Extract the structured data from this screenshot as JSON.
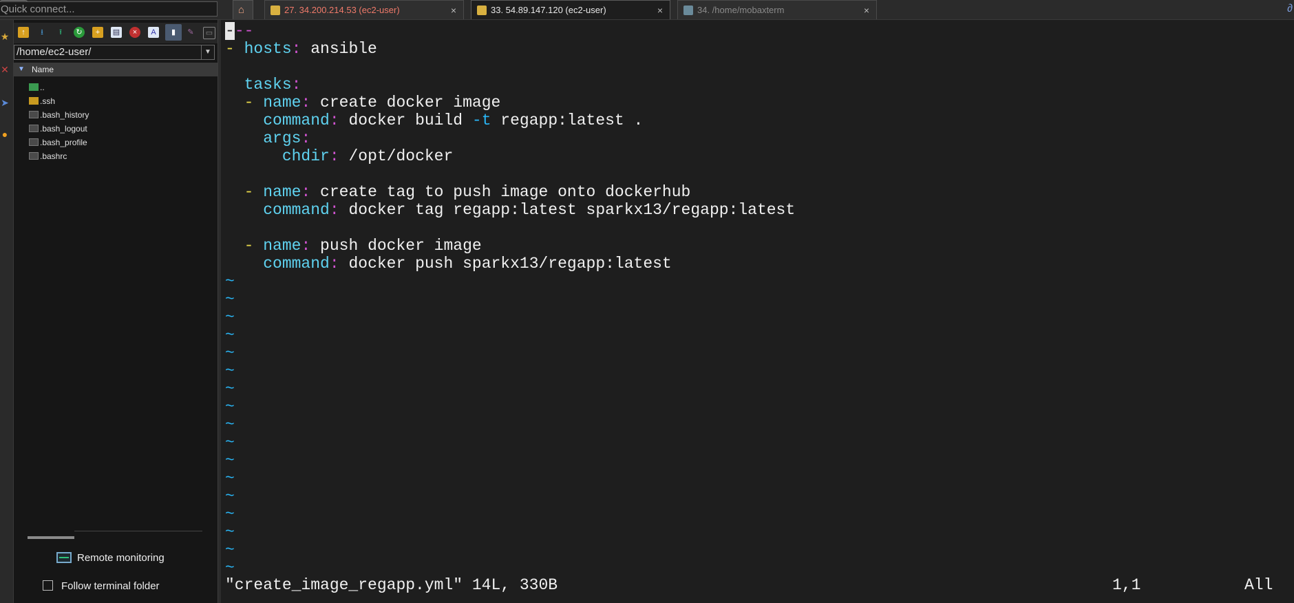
{
  "quick_connect": {
    "placeholder": "Quick connect..."
  },
  "tabs": [
    {
      "label": "27. 34.200.214.53 (ec2-user)"
    },
    {
      "label": "33. 54.89.147.120 (ec2-user)"
    },
    {
      "label": "34. /home/mobaxterm"
    }
  ],
  "close_glyph": "×",
  "add_tab_glyph": "+",
  "sidebar": {
    "path": "/home/ec2-user/",
    "column_name": "Name",
    "files": [
      {
        "name": "..",
        "icon": "parent-folder-icon"
      },
      {
        "name": ".ssh",
        "icon": "folder-icon"
      },
      {
        "name": ".bash_history",
        "icon": "file-icon"
      },
      {
        "name": ".bash_logout",
        "icon": "file-icon"
      },
      {
        "name": ".bash_profile",
        "icon": "file-icon"
      },
      {
        "name": ".bashrc",
        "icon": "file-icon"
      }
    ],
    "remote_monitoring": "Remote monitoring",
    "follow_terminal": "Follow terminal folder"
  },
  "editor": {
    "doc_marker": "--",
    "lines": {
      "l2_dash": "- ",
      "l2_key": "hosts",
      "l2_colon": ":",
      "l2_val": " ansible",
      "l4_key": "tasks",
      "l4_colon": ":",
      "l5_dash": "- ",
      "l5_key": "name",
      "l5_colon": ":",
      "l5_val": " create docker image",
      "l6_key": "command",
      "l6_colon": ":",
      "l6_val1": " docker build ",
      "l6_flag": "-t",
      "l6_val2": " regapp:latest .",
      "l7_key": "args",
      "l7_colon": ":",
      "l8_key": "chdir",
      "l8_colon": ":",
      "l8_val": " /opt/docker",
      "l10_dash": "- ",
      "l10_key": "name",
      "l10_colon": ":",
      "l10_val": " create tag to push image onto dockerhub",
      "l11_key": "command",
      "l11_colon": ":",
      "l11_val": " docker tag regapp:latest sparkx13/regapp:latest",
      "l13_dash": "- ",
      "l13_key": "name",
      "l13_colon": ":",
      "l13_val": " push docker image",
      "l14_key": "command",
      "l14_colon": ":",
      "l14_val": " docker push sparkx13/regapp:latest"
    },
    "tilde": "~",
    "status": "\"create_image_regapp.yml\" 14L, 330B",
    "cursor_pos": "1,1",
    "scroll_scope": "All"
  },
  "colors": {
    "key": "#5fd2f0",
    "punct": "#d154d1",
    "dash": "#e8d84a",
    "tilde": "#29b6f6",
    "tab_inactive": "#f07a6a"
  }
}
